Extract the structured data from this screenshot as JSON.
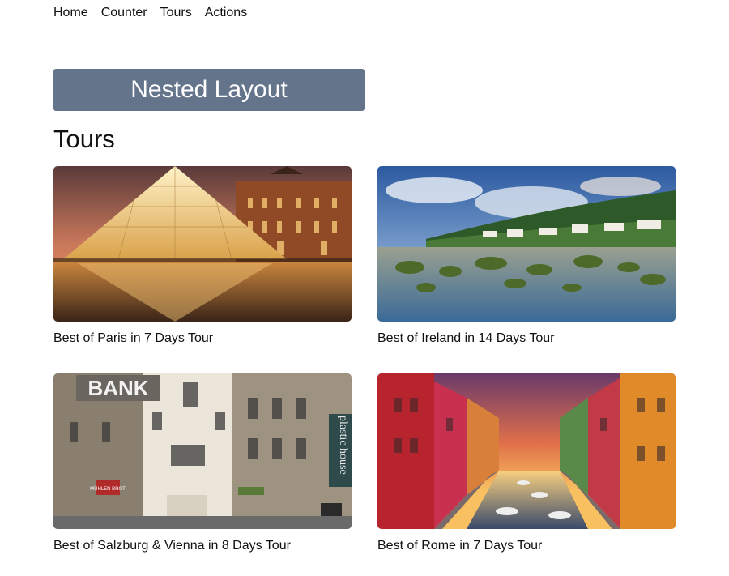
{
  "nav": {
    "items": [
      {
        "label": "Home"
      },
      {
        "label": "Counter"
      },
      {
        "label": "Tours"
      },
      {
        "label": "Actions"
      }
    ]
  },
  "banner": {
    "title": "Nested Layout"
  },
  "page": {
    "title": "Tours"
  },
  "tours": [
    {
      "name": "Best of Paris in 7 Days Tour",
      "image": "louvre-pyramid-night-photo"
    },
    {
      "name": "Best of Ireland in 14 Days Tour",
      "image": "irish-coast-village-photo"
    },
    {
      "name": "Best of Salzburg & Vienna in 8 Days Tour",
      "image": "vienna-street-bank-photo",
      "image_text": [
        "BANK",
        "plastic house",
        "MÜHLEN BROT"
      ]
    },
    {
      "name": "Best of Rome in 7 Days Tour",
      "image": "colorful-canal-sunset-photo"
    }
  ],
  "colors": {
    "banner_bg": "#64748b",
    "text": "#111111"
  }
}
